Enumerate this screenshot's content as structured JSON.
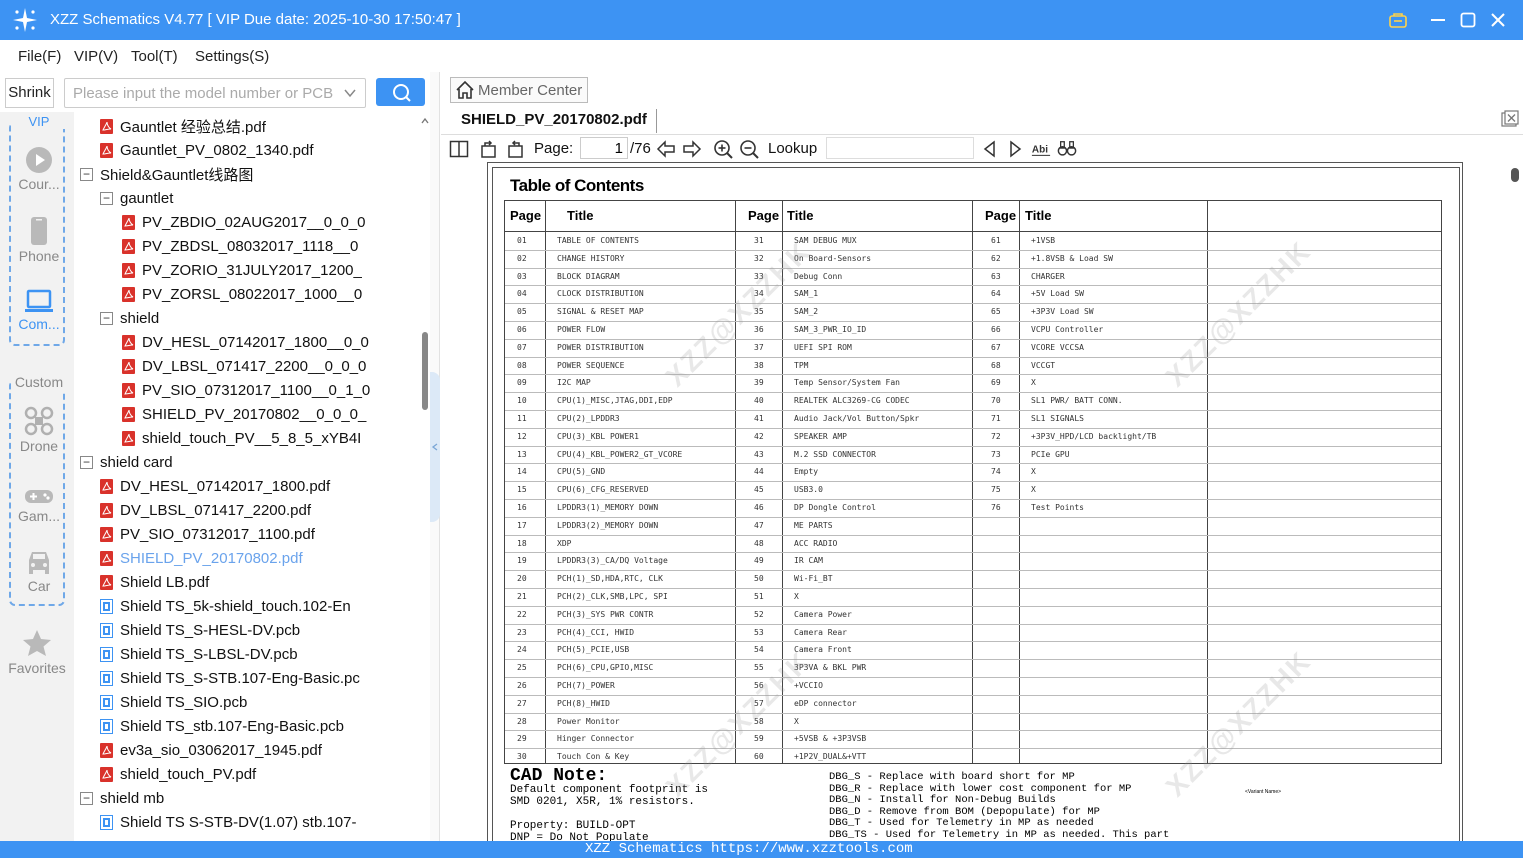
{
  "app": {
    "title": "XZZ Schematics V4.77 [ VIP Due date: 2025-10-30 17:50:47 ]",
    "accent_color": "#3d93f3"
  },
  "menu": [
    "File(F)",
    "VIP(V)",
    "Tool(T)",
    "Settings(S)"
  ],
  "left": {
    "shrink_label": "Shrink",
    "search_placeholder": "Please input the model number or PCB"
  },
  "categories": {
    "vip_group_label": "VIP",
    "vip_items": [
      {
        "label": "Cour...",
        "icon": "play-icon"
      },
      {
        "label": "Phone",
        "icon": "phone-icon"
      },
      {
        "label": "Com...",
        "icon": "laptop-icon"
      }
    ],
    "custom_group_label": "Custom",
    "custom_items": [
      {
        "label": "Drone",
        "icon": "drone-icon"
      },
      {
        "label": "Gam...",
        "icon": "gamepad-icon"
      },
      {
        "label": "Car",
        "icon": "car-icon"
      }
    ],
    "favorites_label": "Favorites"
  },
  "tree": [
    {
      "label": "Gauntlet 经验总结.pdf",
      "type": "pdf",
      "level": 2
    },
    {
      "label": "Gauntlet_PV_0802_1340.pdf",
      "type": "pdf",
      "level": 2
    },
    {
      "label": "Shield&Gauntlet线路图",
      "type": "folder",
      "level": 1
    },
    {
      "label": "gauntlet",
      "type": "folder",
      "level": 2
    },
    {
      "label": "PV_ZBDIO_02AUG2017__0_0_0",
      "type": "pdf",
      "level": 3
    },
    {
      "label": "PV_ZBDSL_08032017_1118__0",
      "type": "pdf",
      "level": 3
    },
    {
      "label": "PV_ZORIO_31JULY2017_1200_",
      "type": "pdf",
      "level": 3
    },
    {
      "label": "PV_ZORSL_08022017_1000__0",
      "type": "pdf",
      "level": 3
    },
    {
      "label": "shield",
      "type": "folder",
      "level": 2
    },
    {
      "label": "DV_HESL_07142017_1800__0_0",
      "type": "pdf",
      "level": 3
    },
    {
      "label": "DV_LBSL_071417_2200__0_0_0",
      "type": "pdf",
      "level": 3
    },
    {
      "label": "PV_SIO_07312017_1100__0_1_0",
      "type": "pdf",
      "level": 3
    },
    {
      "label": "SHIELD_PV_20170802__0_0_0_",
      "type": "pdf",
      "level": 3
    },
    {
      "label": "shield_touch_PV__5_8_5_xYB4I",
      "type": "pdf",
      "level": 3
    },
    {
      "label": "shield card",
      "type": "folder",
      "level": 1
    },
    {
      "label": "DV_HESL_07142017_1800.pdf",
      "type": "pdf",
      "level": 2
    },
    {
      "label": "DV_LBSL_071417_2200.pdf",
      "type": "pdf",
      "level": 2
    },
    {
      "label": "PV_SIO_07312017_1100.pdf",
      "type": "pdf",
      "level": 2
    },
    {
      "label": "SHIELD_PV_20170802.pdf",
      "type": "pdf",
      "level": 2,
      "selected": true
    },
    {
      "label": "Shield LB.pdf",
      "type": "pdf",
      "level": 2
    },
    {
      "label": "Shield TS_5k-shield_touch.102-En",
      "type": "pcb",
      "level": 2
    },
    {
      "label": "Shield TS_S-HESL-DV.pcb",
      "type": "pcb",
      "level": 2
    },
    {
      "label": "Shield TS_S-LBSL-DV.pcb",
      "type": "pcb",
      "level": 2
    },
    {
      "label": "Shield TS_S-STB.107-Eng-Basic.pc",
      "type": "pcb",
      "level": 2
    },
    {
      "label": "Shield TS_SIO.pcb",
      "type": "pcb",
      "level": 2
    },
    {
      "label": "Shield TS_stb.107-Eng-Basic.pcb",
      "type": "pcb",
      "level": 2
    },
    {
      "label": "ev3a_sio_03062017_1945.pdf",
      "type": "pdf",
      "level": 2
    },
    {
      "label": "shield_touch_PV.pdf",
      "type": "pdf",
      "level": 2
    },
    {
      "label": "shield mb",
      "type": "folder",
      "level": 1
    },
    {
      "label": "Shield TS S-STB-DV(1.07) stb.107-",
      "type": "pcb",
      "level": 2
    }
  ],
  "viewer": {
    "member_center": "Member Center",
    "doc_tab": "SHIELD_PV_20170802.pdf",
    "page_label": "Page:",
    "page_value": "1",
    "page_total": "/76",
    "lookup_label": "Lookup"
  },
  "toc": {
    "title": "Table of Contents",
    "headers": {
      "page": "Page",
      "title": "Title"
    },
    "col1": [
      [
        "01",
        "TABLE OF CONTENTS"
      ],
      [
        "02",
        "CHANGE HISTORY"
      ],
      [
        "03",
        "BLOCK DIAGRAM"
      ],
      [
        "04",
        "CLOCK DISTRIBUTION"
      ],
      [
        "05",
        "SIGNAL & RESET MAP"
      ],
      [
        "06",
        "POWER FLOW"
      ],
      [
        "07",
        "POWER DISTRIBUTION"
      ],
      [
        "08",
        "POWER SEQUENCE"
      ],
      [
        "09",
        "I2C MAP"
      ],
      [
        "10",
        "CPU(1)_MISC,JTAG,DDI,EDP"
      ],
      [
        "11",
        "CPU(2)_LPDDR3"
      ],
      [
        "12",
        "CPU(3)_KBL POWER1"
      ],
      [
        "13",
        "CPU(4)_KBL_POWER2_GT_VCORE"
      ],
      [
        "14",
        "CPU(5)_GND"
      ],
      [
        "15",
        "CPU(6)_CFG_RESERVED"
      ],
      [
        "16",
        "LPDDR3(1)_MEMORY DOWN"
      ],
      [
        "17",
        "LPDDR3(2)_MEMORY DOWN"
      ],
      [
        "18",
        "XDP"
      ],
      [
        "19",
        "LPDDR3(3)_CA/DQ Voltage"
      ],
      [
        "20",
        "PCH(1)_SD,HDA,RTC, CLK"
      ],
      [
        "21",
        "PCH(2)_CLK,SMB,LPC, SPI"
      ],
      [
        "22",
        "PCH(3)_SYS PWR CONTR"
      ],
      [
        "23",
        "PCH(4)_CCI, HWID"
      ],
      [
        "24",
        "PCH(5)_PCIE,USB"
      ],
      [
        "25",
        "PCH(6)_CPU,GPIO,MISC"
      ],
      [
        "26",
        "PCH(7)_POWER"
      ],
      [
        "27",
        "PCH(8)_HWID"
      ],
      [
        "28",
        "Power Monitor"
      ],
      [
        "29",
        "Hinger Connector"
      ],
      [
        "30",
        "Touch Con & Key"
      ]
    ],
    "col2": [
      [
        "31",
        "SAM DEBUG MUX"
      ],
      [
        "32",
        "On Board-Sensors"
      ],
      [
        "33",
        "Debug Conn"
      ],
      [
        "34",
        "SAM_1"
      ],
      [
        "35",
        "SAM_2"
      ],
      [
        "36",
        "SAM_3_PWR_IO_ID"
      ],
      [
        "37",
        "UEFI SPI ROM"
      ],
      [
        "38",
        "TPM"
      ],
      [
        "39",
        "Temp Sensor/System Fan"
      ],
      [
        "40",
        "REALTEK ALC3269-CG CODEC"
      ],
      [
        "41",
        "Audio Jack/Vol Button/Spkr"
      ],
      [
        "42",
        "SPEAKER AMP"
      ],
      [
        "43",
        "M.2 SSD CONNECTOR"
      ],
      [
        "44",
        "Empty"
      ],
      [
        "45",
        "USB3.0"
      ],
      [
        "46",
        "DP Dongle Control"
      ],
      [
        "47",
        "ME PARTS"
      ],
      [
        "48",
        "ACC RADIO"
      ],
      [
        "49",
        "IR CAM"
      ],
      [
        "50",
        "Wi-Fi_BT"
      ],
      [
        "51",
        "X"
      ],
      [
        "52",
        "Camera Power"
      ],
      [
        "53",
        "Camera Rear"
      ],
      [
        "54",
        "Camera Front"
      ],
      [
        "55",
        "3P3VA & BKL PWR"
      ],
      [
        "56",
        "+VCCIO"
      ],
      [
        "57",
        "eDP connector"
      ],
      [
        "58",
        "X"
      ],
      [
        "59",
        "+5VSB & +3P3VSB"
      ],
      [
        "60",
        "+1P2V_DUAL&+VTT"
      ]
    ],
    "col3": [
      [
        "61",
        "+1VSB"
      ],
      [
        "62",
        "+1.8VSB & Load SW"
      ],
      [
        "63",
        "CHARGER"
      ],
      [
        "64",
        "+5V Load SW"
      ],
      [
        "65",
        "+3P3V Load SW"
      ],
      [
        "66",
        "VCPU Controller"
      ],
      [
        "67",
        "VCORE VCCSA"
      ],
      [
        "68",
        "VCCGT"
      ],
      [
        "69",
        "X"
      ],
      [
        "70",
        "SL1 PWR/ BATT CONN."
      ],
      [
        "71",
        "SL1 SIGNALS"
      ],
      [
        "72",
        "+3P3V_HPD/LCD backlight/TB"
      ],
      [
        "73",
        "PCIe GPU"
      ],
      [
        "74",
        "X"
      ],
      [
        "75",
        "X"
      ],
      [
        "76",
        "Test Points"
      ]
    ],
    "cad_title": "CAD Note:",
    "cad_lines": [
      "Default component footprint is",
      "SMD 0201, X5R, 1% resistors.",
      "",
      "Property: BUILD-OPT",
      "DNP = Do Not Populate"
    ],
    "dbg_lines": [
      "DBG_S - Replace with board short for MP",
      "DBG_R - Replace with lower cost component for MP",
      "DBG_N - Install for Non-Debug Builds",
      "DBG_D - Remove from BOM (Depopulate) for MP",
      "DBG_T - Used for Telemetry in MP as needed",
      "DBG_TS - Used for Telemetry in MP as needed. This part"
    ],
    "variant_label": "<Variant Name>",
    "watermark": "XZZ@XZZHK"
  },
  "status": "XZZ Schematics https://www.xzztools.com"
}
